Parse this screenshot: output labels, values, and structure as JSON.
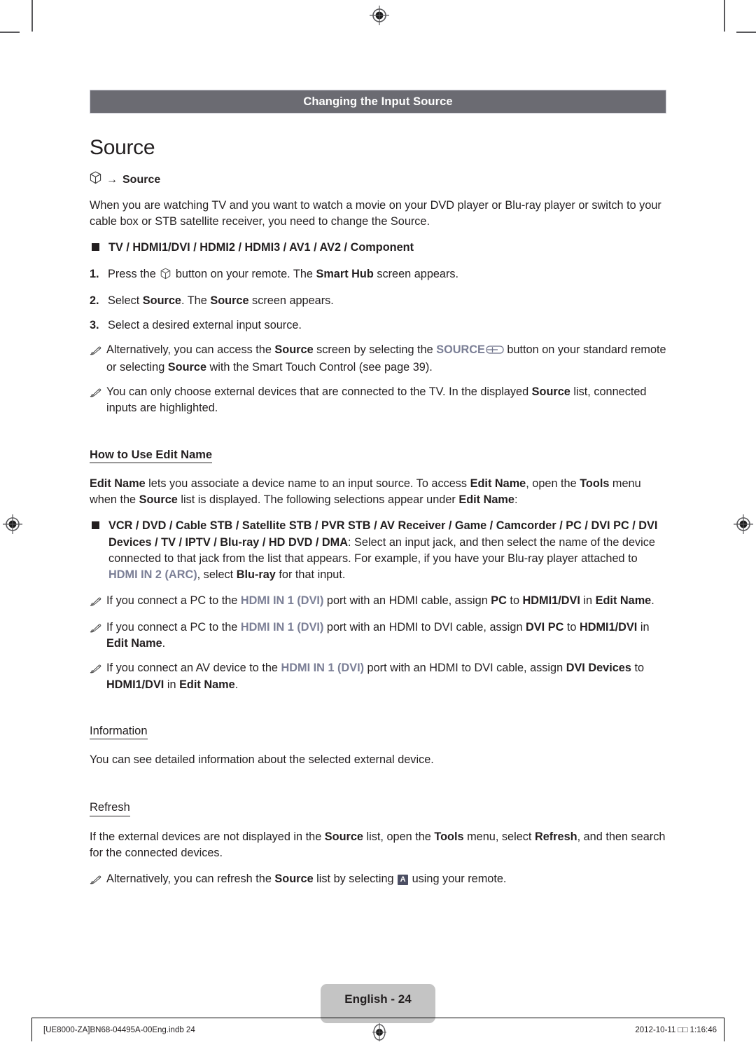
{
  "document": {
    "section_bar_title": "Changing the Input Source",
    "page_title": "Source",
    "accent_color": "#7b7f96",
    "bar_color": "#6b6b72"
  },
  "path": {
    "icon": "smart-hub-cube-icon",
    "arrow": "→",
    "target": "Source"
  },
  "intro": {
    "paragraph": "When you are watching TV and you want to watch a movie on your DVD player or Blu-ray player or switch to your cable box or STB satellite receiver, you need to change the Source."
  },
  "inputs_bullet": {
    "label": "TV / HDMI1/DVI / HDMI2 / HDMI3 / AV1 / AV2 / Component"
  },
  "steps": [
    {
      "num": "1.",
      "pre": "Press the ",
      "icon": "smart-hub-cube-icon",
      "mid": " button on your remote. The ",
      "bold": "Smart Hub",
      "post": " screen appears."
    },
    {
      "num": "2.",
      "pre": "Select ",
      "bold1": "Source",
      "mid": ". The ",
      "bold2": "Source",
      "post": " screen appears."
    },
    {
      "num": "3.",
      "text": "Select a desired external input source."
    }
  ],
  "notes_top": [
    {
      "icon": "pencil-note-icon",
      "p1": "Alternatively, you can access the ",
      "b1": "Source",
      "p2": " screen by selecting the ",
      "accent1": "SOURCE",
      "btn": "source-remote-button-icon",
      "p3": " button on your standard remote or selecting ",
      "b2": "Source",
      "p4": " with the Smart Touch Control (see page 39)."
    },
    {
      "icon": "pencil-note-icon",
      "p1": "You can only choose external devices that are connected to the TV. In the displayed ",
      "b1": "Source",
      "p2": " list, connected inputs are highlighted."
    }
  ],
  "edit_name": {
    "heading": "How to Use Edit Name",
    "body_b1": "Edit Name",
    "body_p1": " lets you associate a device name to an input source. To access ",
    "body_b2": "Edit Name",
    "body_p2": ", open the ",
    "body_b3": "Tools",
    "body_p3": " menu when the ",
    "body_b4": "Source",
    "body_p4": " list is displayed. The following selections appear under ",
    "body_b5": "Edit Name",
    "body_p5": ":"
  },
  "devices_bullet": {
    "list_bold": "VCR / DVD / Cable STB / Satellite STB / PVR STB / AV Receiver / Game / Camcorder / PC / DVI PC / DVI Devices / TV / IPTV / Blu-ray / HD DVD / DMA",
    "tail_1": ": Select an input jack, and then select the name of the device connected to that jack from the list that appears. For example, if you have your Blu-ray player attached to ",
    "accent": "HDMI IN 2 (ARC)",
    "tail_2": ", select ",
    "bold_tail": "Blu-ray",
    "tail_3": " for that input."
  },
  "notes_hdmi": [
    {
      "icon": "pencil-note-icon",
      "p1": "If you connect a PC to the ",
      "accent": "HDMI IN 1 (DVI)",
      "p2": " port with an HDMI cable, assign ",
      "b1": "PC",
      "p3": " to ",
      "b2": "HDMI1/DVI",
      "p4": " in ",
      "b3": "Edit Name",
      "p5": "."
    },
    {
      "icon": "pencil-note-icon",
      "p1": "If you connect a PC to the ",
      "accent": "HDMI IN 1 (DVI)",
      "p2": " port with an HDMI to DVI cable, assign ",
      "b1": "DVI PC",
      "p3": " to ",
      "b2": "HDMI1/DVI",
      "p4": " in ",
      "b3": "Edit Name",
      "p5": "."
    },
    {
      "icon": "pencil-note-icon",
      "p1": "If you connect an AV device to the ",
      "accent": "HDMI IN 1 (DVI)",
      "p2": " port with an HDMI to DVI cable, assign ",
      "b1": "DVI Devices",
      "p3": " to ",
      "b2": "HDMI1/DVI",
      "p4": " in ",
      "b3": "Edit Name",
      "p5": "."
    }
  ],
  "information": {
    "heading": "Information",
    "body": "You can see detailed information about the selected external device."
  },
  "refresh": {
    "heading": "Refresh",
    "body_p1": "If the external devices are not displayed in the ",
    "body_b1": "Source",
    "body_p2": " list, open the ",
    "body_b2": "Tools",
    "body_p3": " menu, select ",
    "body_b3": "Refresh",
    "body_p4": ", and then search for the connected devices.",
    "note_p1": "Alternatively, you can refresh the ",
    "note_b1": "Source",
    "note_p2": " list by selecting ",
    "note_key": "A",
    "note_p3": " using your remote."
  },
  "footer": {
    "page_label": "English - 24",
    "file_ref": "[UE8000-ZA]BN68-04495A-00Eng.indb   24",
    "timestamp": "2012-10-11   □□ 1:16:46"
  }
}
